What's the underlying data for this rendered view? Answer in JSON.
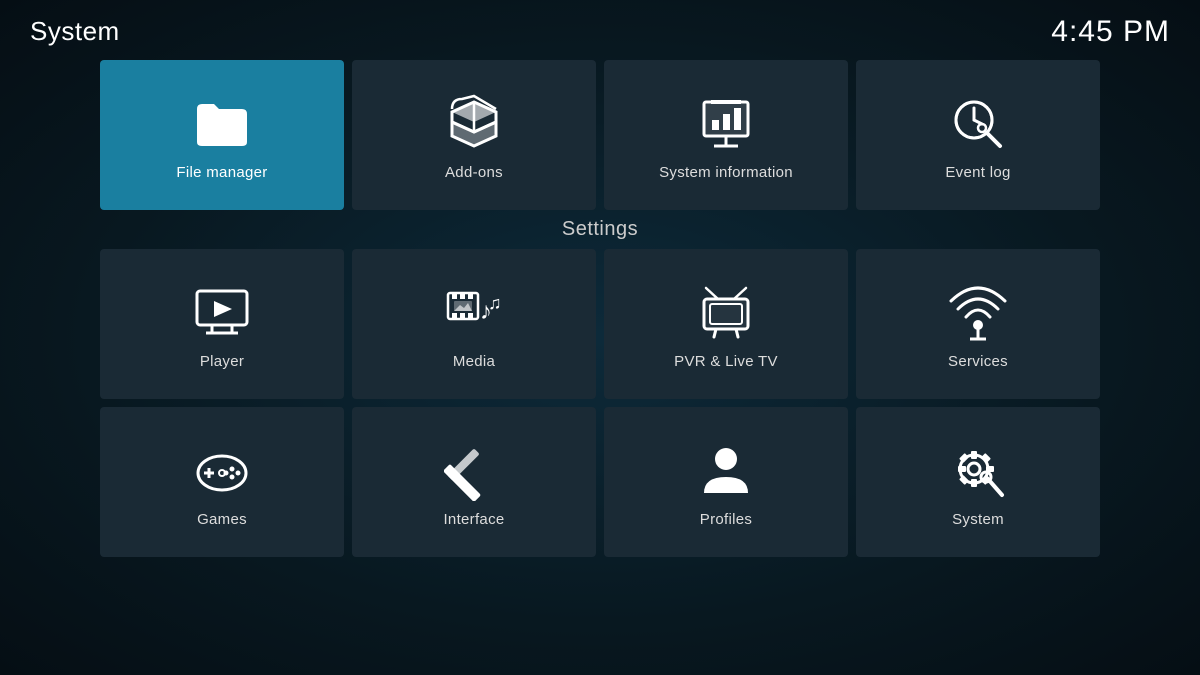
{
  "header": {
    "title": "System",
    "time": "4:45 PM"
  },
  "top_tiles": [
    {
      "id": "file-manager",
      "label": "File manager",
      "active": true
    },
    {
      "id": "add-ons",
      "label": "Add-ons",
      "active": false
    },
    {
      "id": "system-information",
      "label": "System information",
      "active": false
    },
    {
      "id": "event-log",
      "label": "Event log",
      "active": false
    }
  ],
  "settings_label": "Settings",
  "settings_rows": [
    [
      {
        "id": "player",
        "label": "Player"
      },
      {
        "id": "media",
        "label": "Media"
      },
      {
        "id": "pvr-live-tv",
        "label": "PVR & Live TV"
      },
      {
        "id": "services",
        "label": "Services"
      }
    ],
    [
      {
        "id": "games",
        "label": "Games"
      },
      {
        "id": "interface",
        "label": "Interface"
      },
      {
        "id": "profiles",
        "label": "Profiles"
      },
      {
        "id": "system-settings",
        "label": "System"
      }
    ]
  ]
}
